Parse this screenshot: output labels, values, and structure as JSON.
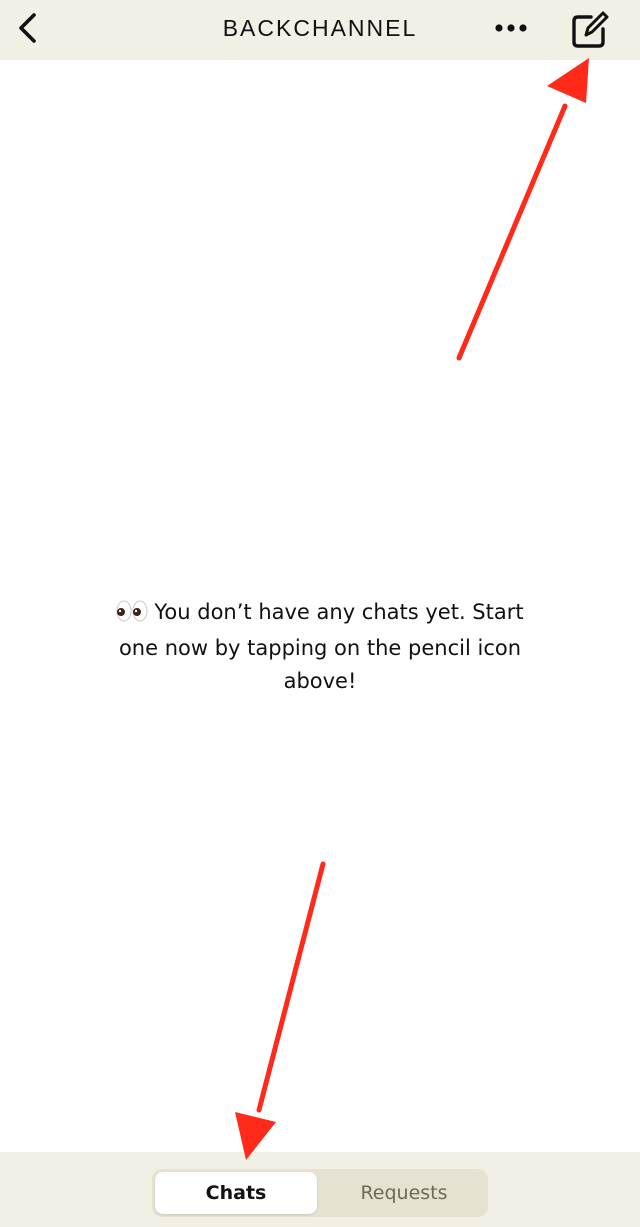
{
  "header": {
    "title": "BACKCHANNEL",
    "back_icon": "chevron-left-icon",
    "more_icon": "ellipsis-icon",
    "compose_icon": "pencil-square-icon"
  },
  "main": {
    "empty_state_emoji": "eyes-icon",
    "empty_state_text": "You don’t have any chats yet. Start one now by tapping on the pencil icon above!"
  },
  "tabs": {
    "items": [
      {
        "label": "Chats",
        "selected": true
      },
      {
        "label": "Requests",
        "selected": false
      }
    ]
  },
  "colors": {
    "bar_background": "#f2f0e4",
    "arrow": "#ff2a1a",
    "text": "#111111",
    "inactive_tab_text": "#6e6858"
  }
}
